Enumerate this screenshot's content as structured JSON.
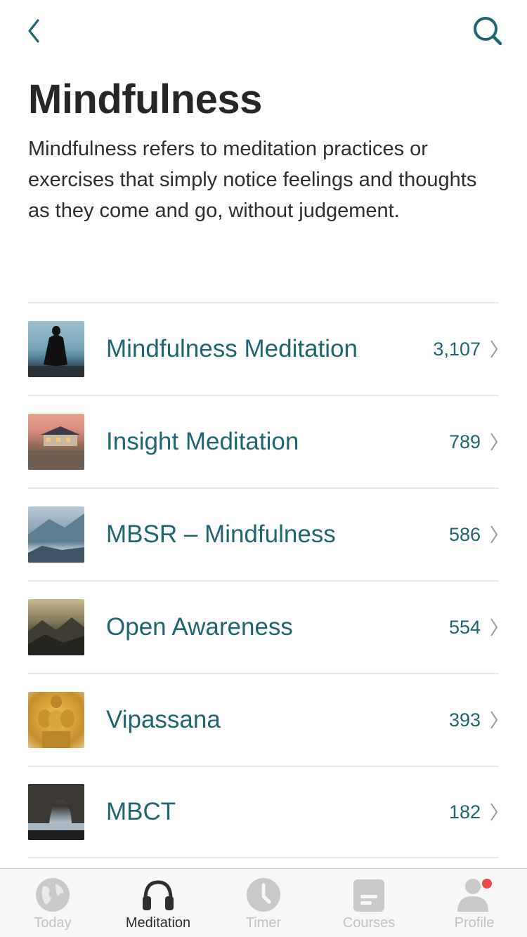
{
  "header": {
    "back_icon": "chevron-left-icon",
    "search_icon": "search-icon",
    "title": "Mindfulness",
    "description": "Mindfulness refers to meditation practices or exercises that simply notice feelings and thoughts as they come and go, without judgement."
  },
  "list": [
    {
      "label": "Mindfulness Meditation",
      "count": "3,107",
      "thumb": "seated-silhouette-by-sea"
    },
    {
      "label": "Insight Meditation",
      "count": "789",
      "thumb": "retreat-building-at-sunset"
    },
    {
      "label": "MBSR – Mindfulness",
      "count": "586",
      "thumb": "misty-mountains"
    },
    {
      "label": "Open Awareness",
      "count": "554",
      "thumb": "mountain-valley"
    },
    {
      "label": "Vipassana",
      "count": "393",
      "thumb": "golden-buddha-heads"
    },
    {
      "label": "MBCT",
      "count": "182",
      "thumb": "rock-arch-over-water"
    }
  ],
  "tabbar": {
    "tabs": [
      {
        "label": "Today",
        "icon": "globe-icon",
        "active": false
      },
      {
        "label": "Meditation",
        "icon": "headphones-icon",
        "active": true
      },
      {
        "label": "Timer",
        "icon": "clock-icon",
        "active": false
      },
      {
        "label": "Courses",
        "icon": "courses-icon",
        "active": false
      },
      {
        "label": "Profile",
        "icon": "profile-icon",
        "active": false,
        "badge": true
      }
    ]
  },
  "colors": {
    "accent": "#1e6670",
    "title": "#262626",
    "tab_inactive": "#c2c2c2",
    "tab_active": "#2e2e2e",
    "badge": "#e84a4a"
  }
}
